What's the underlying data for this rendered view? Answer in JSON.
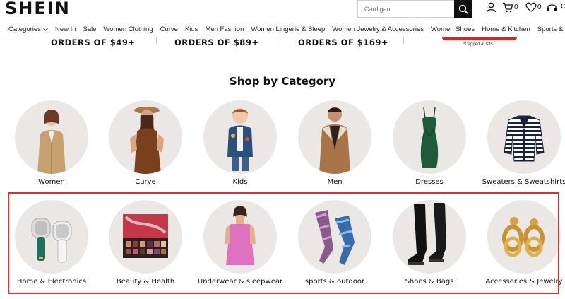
{
  "header": {
    "logo": "SHEIN",
    "search_placeholder": "Cardigan",
    "cart_count": "0",
    "wishlist_count": "0",
    "partial": "C"
  },
  "nav": {
    "items": [
      "Categories",
      "New In",
      "Sale",
      "Women Clothing",
      "Curve",
      "Kids",
      "Men Fashion",
      "Women Lingerie & Sleep",
      "Women Jewelry & Accessories",
      "Women Shoes",
      "Home & Kitchen",
      "Sports & Outd"
    ]
  },
  "promo": {
    "items": [
      "ORDERS OF $49+",
      "ORDERS OF $89+",
      "ORDERS OF $169+"
    ],
    "capped": "*Capped at $35"
  },
  "section_title": "Shop by Category",
  "categories": {
    "row1": [
      {
        "label": "Women",
        "icon": "woman-trench-coat-image"
      },
      {
        "label": "Curve",
        "icon": "curve-brown-dress-image"
      },
      {
        "label": "Kids",
        "icon": "kid-jacket-image"
      },
      {
        "label": "Men",
        "icon": "man-suede-jacket-image"
      },
      {
        "label": "Dresses",
        "icon": "green-velvet-dress-image"
      },
      {
        "label": "Sweaters & Sweatshirts",
        "icon": "striped-cardigan-image"
      }
    ],
    "row2": [
      {
        "label": "Home & Electronics",
        "icon": "lint-remover-image"
      },
      {
        "label": "Beauty & Health",
        "icon": "eyeshadow-palette-image"
      },
      {
        "label": "Underwear & sleepwear",
        "icon": "pink-sleepwear-image"
      },
      {
        "label": "sports & outdoor",
        "icon": "leggings-image"
      },
      {
        "label": "Shoes & Bags",
        "icon": "black-boots-image"
      },
      {
        "label": "Accessories & Jewelry",
        "icon": "gold-earrings-image"
      }
    ]
  },
  "colors": {
    "highlight": "#d93030",
    "circle_bg": "#ebe7e4",
    "promo_accent": "#e02020"
  }
}
